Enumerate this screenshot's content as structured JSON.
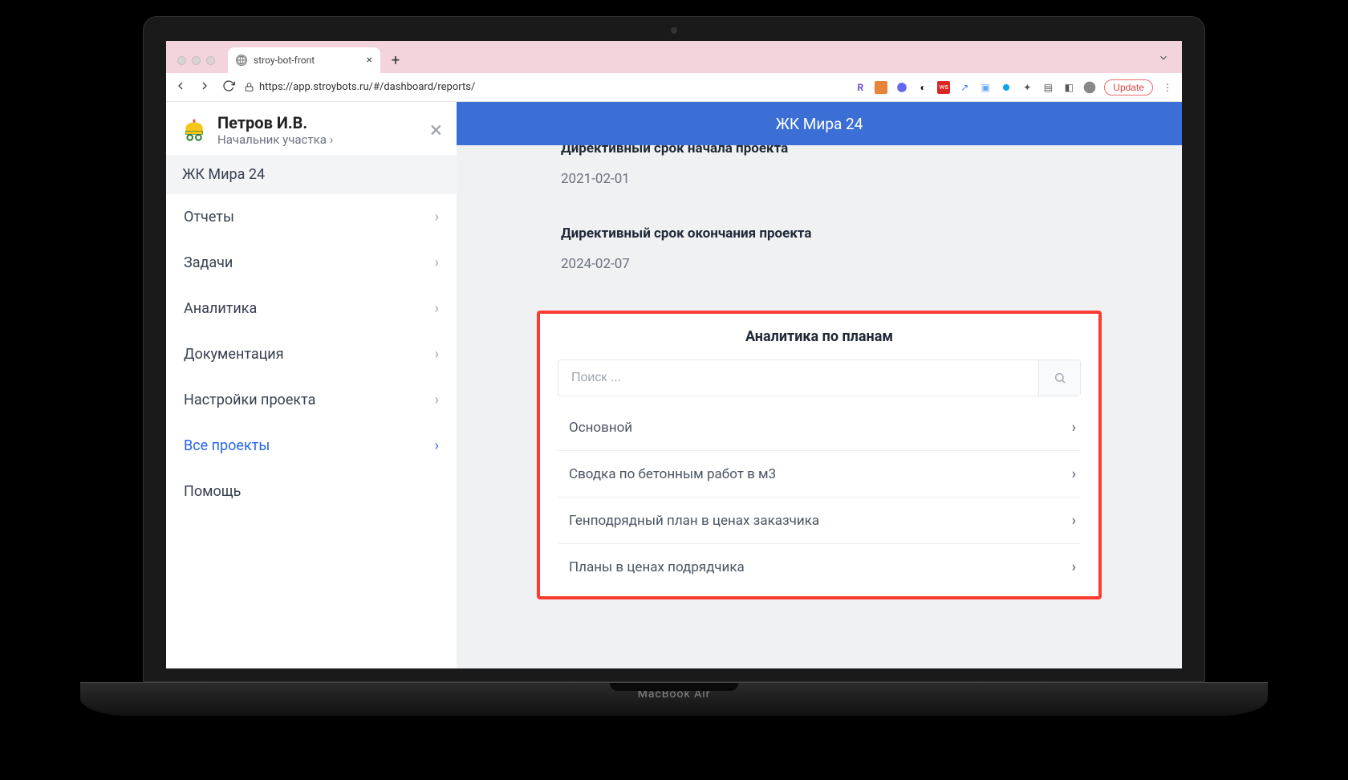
{
  "browser": {
    "tab_title": "stroy-bot-front",
    "url": "https://app.stroybots.ru/#/dashboard/reports/",
    "update_label": "Update"
  },
  "sidebar": {
    "user_name": "Петров И.В.",
    "user_role": "Начальник участка",
    "project": "ЖК Мира 24",
    "items": [
      {
        "label": "Отчеты",
        "active": false
      },
      {
        "label": "Задачи",
        "active": false
      },
      {
        "label": "Аналитика",
        "active": false
      },
      {
        "label": "Документация",
        "active": false
      },
      {
        "label": "Настройки проекта",
        "active": false
      },
      {
        "label": "Все проекты",
        "active": true
      },
      {
        "label": "Помощь",
        "active": false,
        "no_chevron": true
      }
    ]
  },
  "topbar": {
    "title": "ЖК Мира 24"
  },
  "info": {
    "start_label": "Директивный срок начала проекта",
    "start_value": "2021-02-01",
    "end_label": "Директивный срок окончания проекта",
    "end_value": "2024-02-07"
  },
  "analytics": {
    "title": "Аналитика по планам",
    "search_placeholder": "Поиск ...",
    "plans": [
      "Основной",
      "Сводка по бетонным работ в м3",
      "Генподрядный план в ценах заказчика",
      "Планы в ценах подрядчика"
    ]
  },
  "laptop_label": "MacBook Air"
}
